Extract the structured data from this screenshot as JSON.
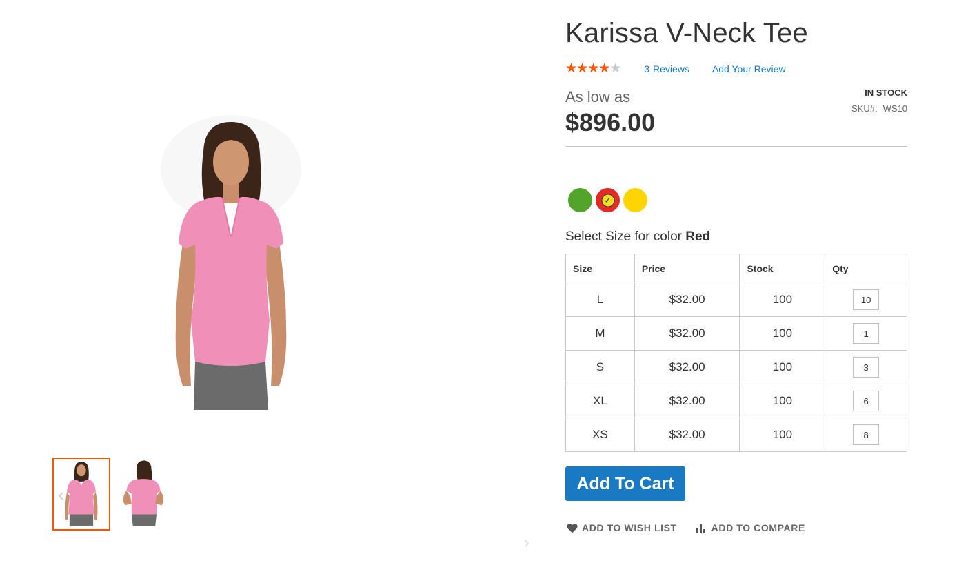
{
  "product": {
    "title": "Karissa V-Neck Tee",
    "rating_stars": 4,
    "rating_max": 5,
    "reviews_count": "3",
    "reviews_label": "Reviews",
    "add_review_label": "Add Your Review",
    "price_prefix": "As low as",
    "price": "$896.00",
    "stock_status": "In stock",
    "sku_label": "SKU#:",
    "sku": "WS10"
  },
  "gallery": {
    "main_image": "woman-pink-vneck-tee-front",
    "thumbnails": [
      {
        "icon": "tee-front-thumb",
        "selected": true
      },
      {
        "icon": "tee-back-thumb",
        "selected": false
      }
    ],
    "prev_glyph": "‹",
    "next_glyph": "›"
  },
  "colors": {
    "swatches": [
      {
        "name": "Green",
        "hex": "#53a42a",
        "selected": false
      },
      {
        "name": "Red",
        "hex": "#e02b27",
        "selected": true
      },
      {
        "name": "Yellow",
        "hex": "#ffd500",
        "selected": false
      }
    ],
    "check_glyph": "✓",
    "select_size_prefix": "Select Size for color",
    "selected_color": "Red"
  },
  "size_table": {
    "headers": [
      "Size",
      "Price",
      "Stock",
      "Qty"
    ],
    "rows": [
      {
        "size": "L",
        "price": "$32.00",
        "stock": "100",
        "qty": "10"
      },
      {
        "size": "M",
        "price": "$32.00",
        "stock": "100",
        "qty": "1"
      },
      {
        "size": "S",
        "price": "$32.00",
        "stock": "100",
        "qty": "3"
      },
      {
        "size": "XL",
        "price": "$32.00",
        "stock": "100",
        "qty": "6"
      },
      {
        "size": "XS",
        "price": "$32.00",
        "stock": "100",
        "qty": "8"
      }
    ]
  },
  "actions": {
    "add_to_cart": "Add To Cart",
    "wish_list": "Add to Wish List",
    "compare": "Add to Compare"
  },
  "colors_theme": {
    "accent": "#1979c3",
    "rating": "#ff5501",
    "thumb_active_border": "#ff5501"
  }
}
